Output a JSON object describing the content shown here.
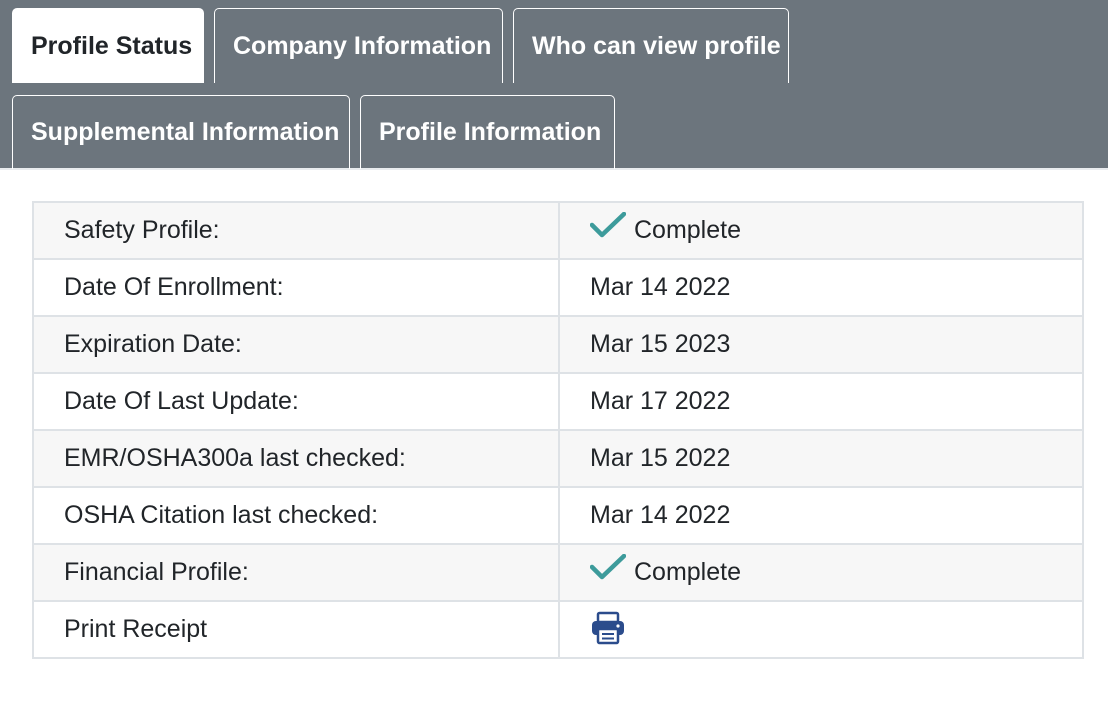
{
  "tabs": [
    {
      "label": "Profile Status",
      "active": true
    },
    {
      "label": "Company Information",
      "active": false
    },
    {
      "label": "Who can view profile",
      "active": false
    },
    {
      "label": "Supplemental Information",
      "active": false
    },
    {
      "label": "Profile Information",
      "active": false
    }
  ],
  "status_rows": [
    {
      "label": "Safety Profile:",
      "value": "Complete",
      "icon": "check-icon"
    },
    {
      "label": "Date Of Enrollment:",
      "value": "Mar 14 2022"
    },
    {
      "label": "Expiration Date:",
      "value": "Mar 15 2023"
    },
    {
      "label": "Date Of Last Update:",
      "value": "Mar 17 2022"
    },
    {
      "label": "EMR/OSHA300a last checked:",
      "value": "Mar 15 2022"
    },
    {
      "label": "OSHA Citation last checked:",
      "value": "Mar 14 2022"
    },
    {
      "label": "Financial Profile:",
      "value": "Complete",
      "icon": "check-icon"
    },
    {
      "label": "Print Receipt",
      "icon": "printer-icon"
    }
  ],
  "colors": {
    "tabbar_bg": "#6c757d",
    "check": "#3d9b9b",
    "printer": "#2b4c8c"
  }
}
